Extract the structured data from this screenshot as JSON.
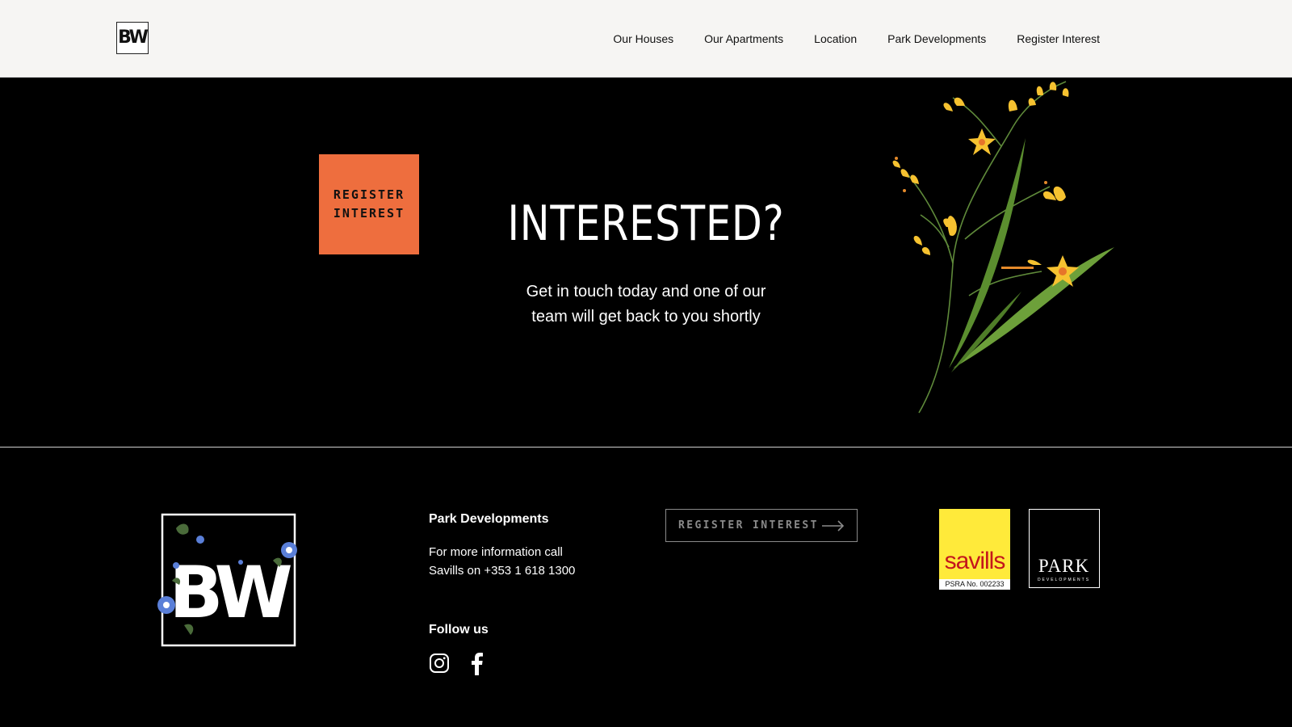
{
  "header": {
    "logo_text": "BW",
    "nav": [
      {
        "label": "Our Houses"
      },
      {
        "label": "Our Apartments"
      },
      {
        "label": "Location"
      },
      {
        "label": "Park Developments"
      },
      {
        "label": "Register Interest"
      }
    ]
  },
  "hero": {
    "register_box_line1": "REGISTER",
    "register_box_line2": "INTEREST",
    "title": "INTERESTED?",
    "subtitle_line1": "Get in touch today and one of our",
    "subtitle_line2": "team will get back to you shortly"
  },
  "footer": {
    "logo_text": "BW",
    "company_title": "Park Developments",
    "info_line1": "For more information call",
    "info_line2": "Savills on +353 1 618 1300",
    "follow_title": "Follow us",
    "social": [
      {
        "icon": "instagram-icon"
      },
      {
        "icon": "facebook-icon"
      }
    ],
    "register_button": "REGISTER INTEREST",
    "savills_word": "savills",
    "savills_psra": "PSRA No. 002233",
    "park_word": "PARK",
    "park_sub": "DEVELOPMENTS"
  },
  "colors": {
    "accent_orange": "#ee6e3e",
    "header_bg": "#f6f5f3",
    "savills_yellow": "#ffea3a",
    "savills_red": "#c4161c"
  }
}
